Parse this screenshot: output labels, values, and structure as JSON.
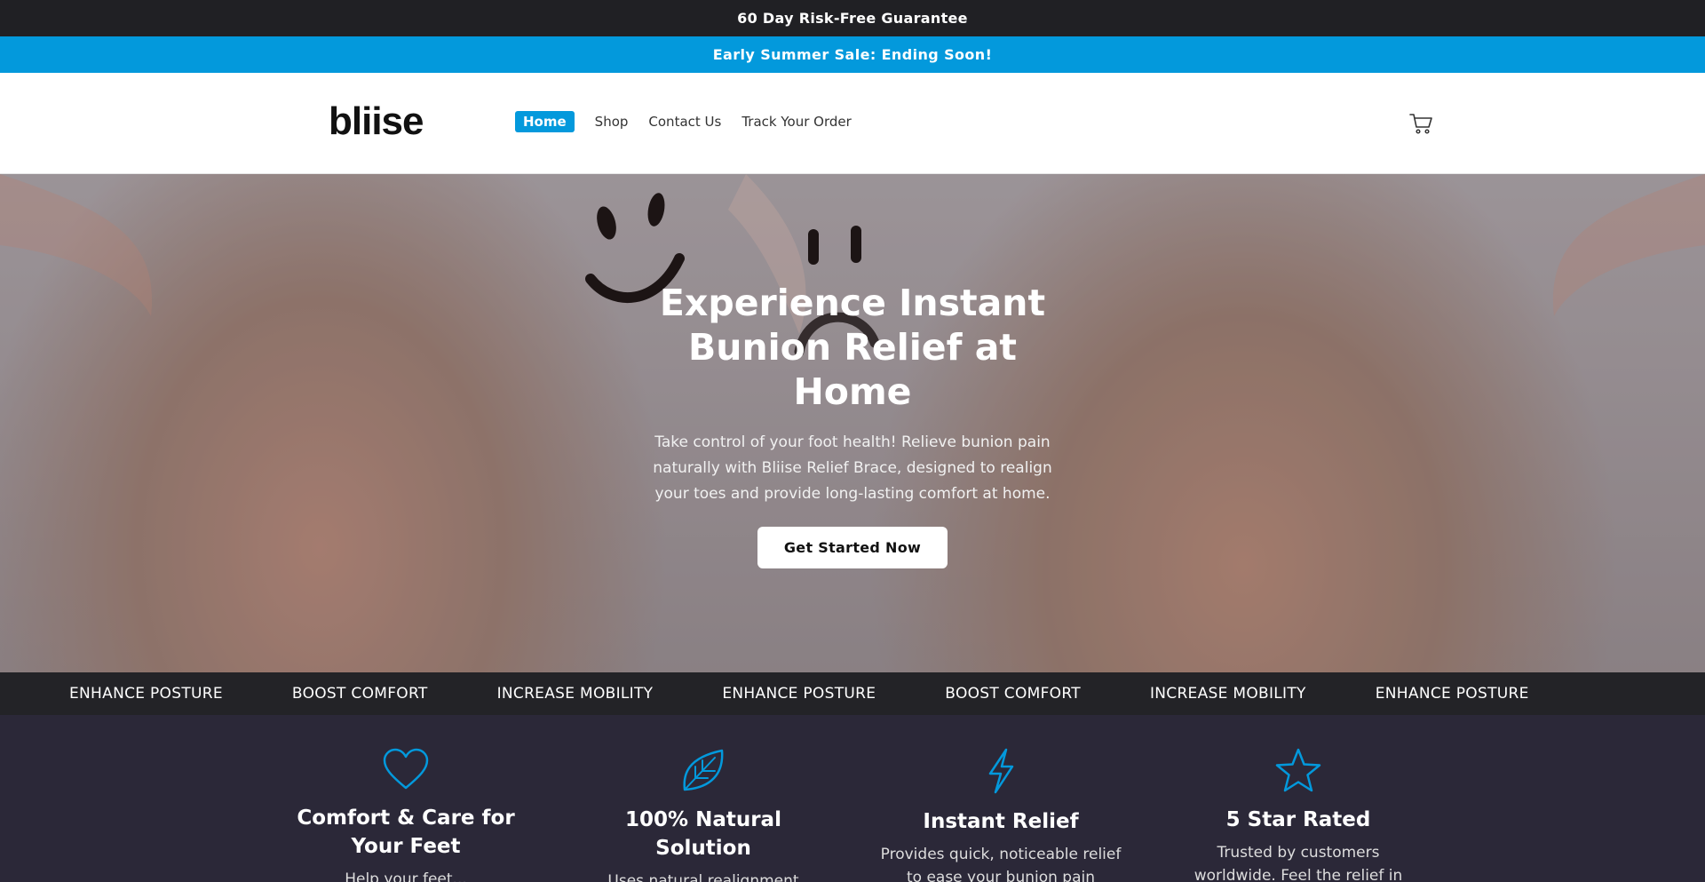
{
  "topbar": {
    "text": "60 Day Risk-Free Guarantee"
  },
  "salebar": {
    "text": "Early Summer Sale: Ending Soon!"
  },
  "header": {
    "logo": "bliise",
    "nav": [
      {
        "label": "Home",
        "active": true
      },
      {
        "label": "Shop"
      },
      {
        "label": "Contact Us"
      },
      {
        "label": "Track Your Order"
      }
    ],
    "cart_icon": "cart-icon"
  },
  "hero": {
    "title": "Experience Instant Bunion Relief at Home",
    "subtitle": "Take control of your foot health! Relieve bunion pain naturally with Bliise Relief Brace, designed to realign your toes and provide long-lasting comfort at home.",
    "cta": "Get Started Now"
  },
  "ticker": [
    "ENHANCE POSTURE",
    "BOOST COMFORT",
    "INCREASE MOBILITY",
    "ENHANCE POSTURE",
    "BOOST COMFORT",
    "INCREASE MOBILITY",
    "ENHANCE POSTURE"
  ],
  "features": [
    {
      "icon": "heart-icon",
      "title": "Comfort & Care for Your Feet",
      "text": "Help your feet..."
    },
    {
      "icon": "leaf-icon",
      "title": "100% Natural Solution",
      "text": "Uses natural realignment"
    },
    {
      "icon": "bolt-icon",
      "title": "Instant Relief",
      "text": "Provides quick, noticeable relief to ease your bunion pain"
    },
    {
      "icon": "star-icon",
      "title": "5 Star Rated",
      "text": "Trusted by customers worldwide. Feel the relief in"
    }
  ],
  "colors": {
    "accent": "#0399dc",
    "topbar": "#202024",
    "footer_band": "#2b2838"
  }
}
